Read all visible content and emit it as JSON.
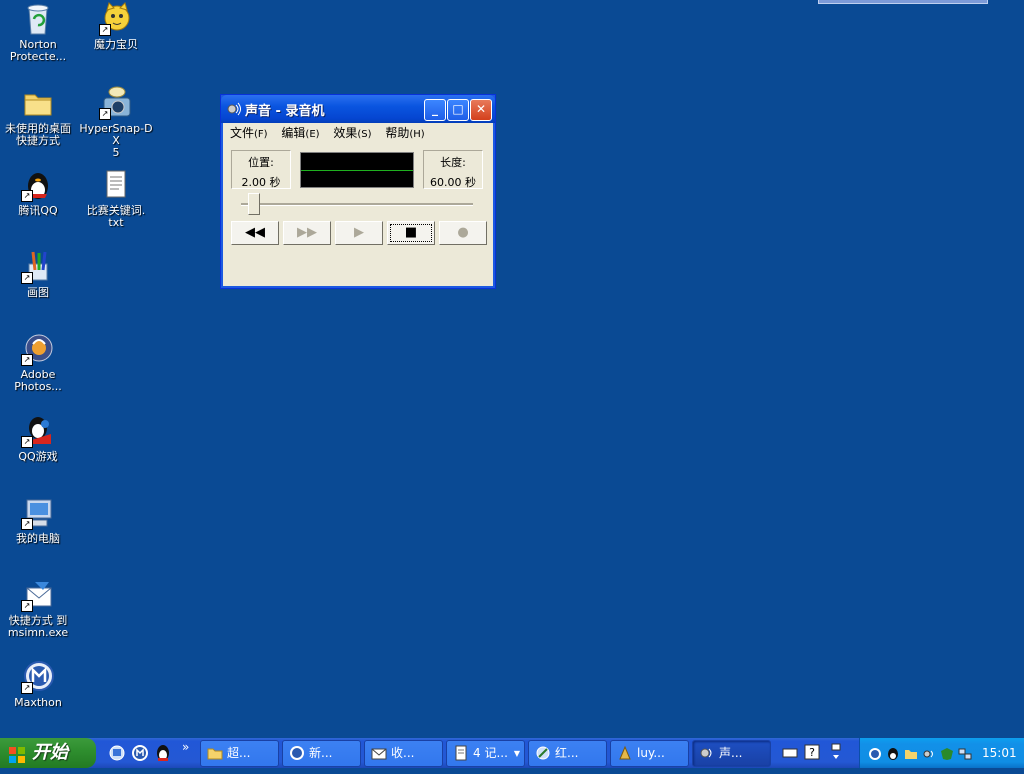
{
  "desktop": {
    "icons": [
      {
        "label": "Norton\nProtecte...",
        "icon": "recycle-bin-icon"
      },
      {
        "label": "魔力宝贝",
        "icon": "game-cat-icon"
      },
      {
        "label": "未使用的桌面\n快捷方式",
        "icon": "folder-icon"
      },
      {
        "label": "HyperSnap-DX\n5",
        "icon": "camera-icon"
      },
      {
        "label": "腾讯QQ",
        "icon": "qq-penguin-icon"
      },
      {
        "label": "比赛关键词.\ntxt",
        "icon": "text-file-icon"
      },
      {
        "label": "画图",
        "icon": "paint-icon"
      },
      {
        "label": "Adobe\nPhotos...",
        "icon": "photoshop-icon"
      },
      {
        "label": "QQ游戏",
        "icon": "qq-game-icon"
      },
      {
        "label": "我的电脑",
        "icon": "my-computer-icon"
      },
      {
        "label": "快捷方式 到\nmsimn.exe",
        "icon": "outlook-express-icon"
      },
      {
        "label": "Maxthon",
        "icon": "maxthon-icon"
      }
    ]
  },
  "window": {
    "title": "声音 - 录音机",
    "menu": [
      {
        "label": "文件",
        "key": "(F)"
      },
      {
        "label": "编辑",
        "key": "(E)"
      },
      {
        "label": "效果",
        "key": "(S)"
      },
      {
        "label": "帮助",
        "key": "(H)"
      }
    ],
    "position_label": "位置:",
    "position_value": "2.00 秒",
    "length_label": "长度:",
    "length_value": "60.00 秒",
    "playback_position_fraction": 0.033,
    "buttons": [
      {
        "name": "rewind",
        "glyph": "◀◀",
        "enabled": true
      },
      {
        "name": "fast-forward",
        "glyph": "▶▶",
        "enabled": false
      },
      {
        "name": "play",
        "glyph": "▶",
        "enabled": false
      },
      {
        "name": "stop",
        "glyph": "■",
        "enabled": true
      },
      {
        "name": "record",
        "glyph": "●",
        "enabled": false
      }
    ],
    "title_buttons": {
      "minimize": "_",
      "maximize": "□",
      "close": "✕"
    }
  },
  "taskbar": {
    "start_label": "开始",
    "quicklaunch_more": "»",
    "tasks": [
      {
        "label": "超...",
        "icon": "folder-icon"
      },
      {
        "label": "新...",
        "icon": "maxthon-icon"
      },
      {
        "label": "收...",
        "icon": "mail-icon"
      },
      {
        "label": "4 记...",
        "icon": "notepad-icon",
        "group_arrow": "▼"
      },
      {
        "label": "红...",
        "icon": "app-icon"
      },
      {
        "label": "luy...",
        "icon": "game-icon"
      },
      {
        "label": "声...",
        "icon": "sound-recorder-icon",
        "active": true
      }
    ],
    "clock": "15:01"
  },
  "colors": {
    "desktop": "#0a4a94",
    "taskbar": "#2458d4",
    "start": "#2f8f2f",
    "tray": "#108ee4"
  }
}
